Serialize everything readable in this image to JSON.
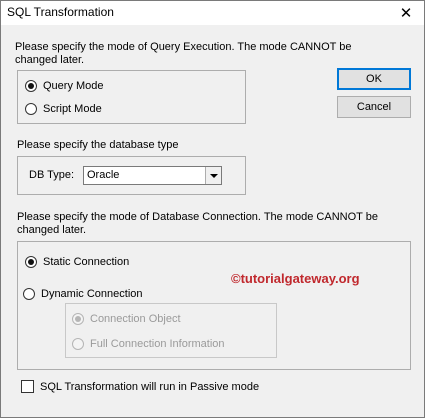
{
  "window": {
    "title": "SQL Transformation",
    "close_glyph": "✕"
  },
  "execution_mode": {
    "description": "Please specify the mode of Query Execution. The mode CANNOT be changed later.",
    "options": [
      {
        "label": "Query Mode",
        "selected": true
      },
      {
        "label": "Script Mode",
        "selected": false
      }
    ]
  },
  "buttons": {
    "ok": "OK",
    "cancel": "Cancel"
  },
  "database": {
    "description": "Please specify the database type",
    "db_type_label": "DB Type:",
    "db_type_value": "Oracle"
  },
  "connection": {
    "description": "Please specify the mode of Database Connection. The mode CANNOT be changed later.",
    "options": [
      {
        "label": "Static Connection",
        "selected": true
      },
      {
        "label": "Dynamic Connection",
        "selected": false
      }
    ],
    "dynamic_options": [
      {
        "label": "Connection Object",
        "selected": true,
        "enabled": false
      },
      {
        "label": "Full Connection Information",
        "selected": false,
        "enabled": false
      }
    ]
  },
  "passive_mode": {
    "label": "SQL Transformation will run in Passive mode",
    "checked": false
  },
  "watermark": "©tutorialgateway.org"
}
